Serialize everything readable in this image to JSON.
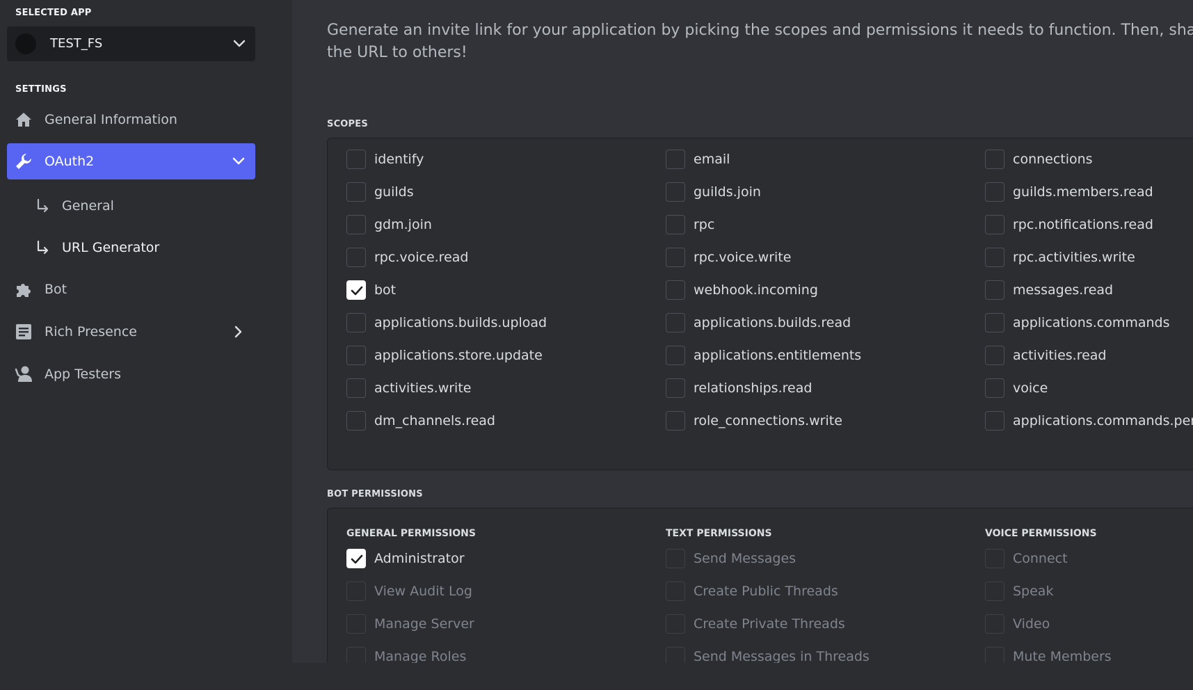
{
  "sidebar": {
    "selected_app_label": "SELECTED APP",
    "app_name": "TEST_FS",
    "settings_label": "SETTINGS",
    "items": [
      {
        "label": "General Information",
        "icon": "home-icon"
      },
      {
        "label": "OAuth2",
        "icon": "wrench-icon",
        "active": true
      },
      {
        "label": "General",
        "icon": "sub-arrow-icon"
      },
      {
        "label": "URL Generator",
        "icon": "sub-arrow-icon",
        "selected": true
      },
      {
        "label": "Bot",
        "icon": "puzzle-icon"
      },
      {
        "label": "Rich Presence",
        "icon": "document-icon"
      },
      {
        "label": "App Testers",
        "icon": "person-icon"
      }
    ]
  },
  "main": {
    "intro": "Generate an invite link for your application by picking the scopes and permissions it needs to function. Then, share the URL to others!",
    "scopes_heading": "SCOPES",
    "scopes": [
      {
        "label": "identify",
        "checked": false
      },
      {
        "label": "email",
        "checked": false
      },
      {
        "label": "connections",
        "checked": false
      },
      {
        "label": "guilds",
        "checked": false
      },
      {
        "label": "guilds.join",
        "checked": false
      },
      {
        "label": "guilds.members.read",
        "checked": false
      },
      {
        "label": "gdm.join",
        "checked": false
      },
      {
        "label": "rpc",
        "checked": false
      },
      {
        "label": "rpc.notifications.read",
        "checked": false
      },
      {
        "label": "rpc.voice.read",
        "checked": false
      },
      {
        "label": "rpc.voice.write",
        "checked": false
      },
      {
        "label": "rpc.activities.write",
        "checked": false
      },
      {
        "label": "bot",
        "checked": true
      },
      {
        "label": "webhook.incoming",
        "checked": false
      },
      {
        "label": "messages.read",
        "checked": false
      },
      {
        "label": "applications.builds.upload",
        "checked": false
      },
      {
        "label": "applications.builds.read",
        "checked": false
      },
      {
        "label": "applications.commands",
        "checked": false
      },
      {
        "label": "applications.store.update",
        "checked": false
      },
      {
        "label": "applications.entitlements",
        "checked": false
      },
      {
        "label": "activities.read",
        "checked": false
      },
      {
        "label": "activities.write",
        "checked": false
      },
      {
        "label": "relationships.read",
        "checked": false
      },
      {
        "label": "voice",
        "checked": false
      },
      {
        "label": "dm_channels.read",
        "checked": false
      },
      {
        "label": "role_connections.write",
        "checked": false
      },
      {
        "label": "applications.commands.permissions.update",
        "checked": false
      }
    ],
    "bot_permissions_heading": "BOT PERMISSIONS",
    "permission_groups": [
      {
        "heading": "GENERAL PERMISSIONS",
        "items": [
          {
            "label": "Administrator",
            "checked": true,
            "disabled": false
          },
          {
            "label": "View Audit Log",
            "checked": false,
            "disabled": true
          },
          {
            "label": "Manage Server",
            "checked": false,
            "disabled": true
          },
          {
            "label": "Manage Roles",
            "checked": false,
            "disabled": true
          }
        ]
      },
      {
        "heading": "TEXT PERMISSIONS",
        "items": [
          {
            "label": "Send Messages",
            "checked": false,
            "disabled": true
          },
          {
            "label": "Create Public Threads",
            "checked": false,
            "disabled": true
          },
          {
            "label": "Create Private Threads",
            "checked": false,
            "disabled": true
          },
          {
            "label": "Send Messages in Threads",
            "checked": false,
            "disabled": true
          }
        ]
      },
      {
        "heading": "VOICE PERMISSIONS",
        "items": [
          {
            "label": "Connect",
            "checked": false,
            "disabled": true
          },
          {
            "label": "Speak",
            "checked": false,
            "disabled": true
          },
          {
            "label": "Video",
            "checked": false,
            "disabled": true
          },
          {
            "label": "Mute Members",
            "checked": false,
            "disabled": true
          }
        ]
      }
    ]
  }
}
